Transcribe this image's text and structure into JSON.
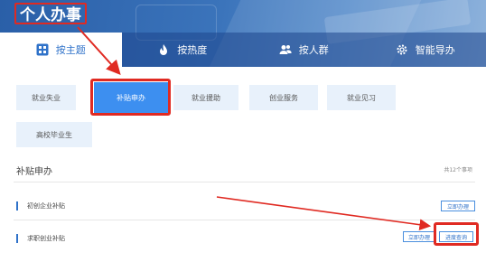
{
  "header": {
    "title": "个人办事"
  },
  "tabs": [
    {
      "label": "按主题",
      "icon": "grid-icon",
      "active": true
    },
    {
      "label": "按热度",
      "icon": "flame-icon",
      "active": false
    },
    {
      "label": "按人群",
      "icon": "people-icon",
      "active": false
    },
    {
      "label": "智能导办",
      "icon": "gear-icon",
      "active": false
    }
  ],
  "categories": [
    {
      "label": "就业失业",
      "selected": false
    },
    {
      "label": "补贴申办",
      "selected": true
    },
    {
      "label": "就业援助",
      "selected": false
    },
    {
      "label": "创业服务",
      "selected": false
    },
    {
      "label": "就业见习",
      "selected": false
    },
    {
      "label": "高校毕业生",
      "selected": false
    }
  ],
  "section": {
    "title": "补贴申办",
    "count": "共12个事项"
  },
  "items": [
    {
      "label": "初创企业补贴",
      "buttons": [
        "立即办理"
      ]
    },
    {
      "label": "求职创业补贴",
      "buttons": [
        "立即办理",
        "进度查询"
      ]
    }
  ],
  "colors": {
    "accent": "#2f72c9",
    "highlight": "#e02a22",
    "selected_bg": "#3d8ff0",
    "chip_bg": "#e8f1fb"
  }
}
